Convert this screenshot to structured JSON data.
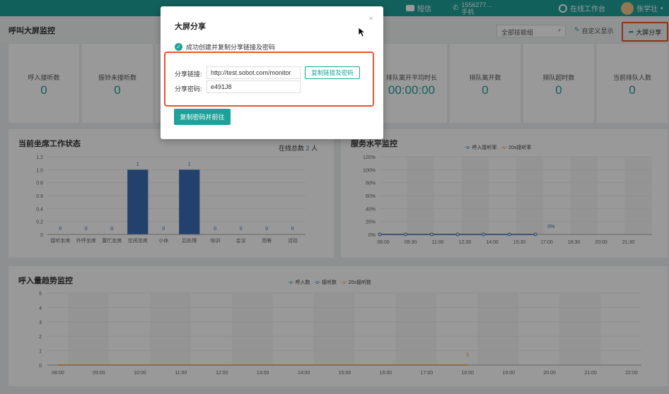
{
  "topbar": {
    "sms_label": "短信",
    "phone_number": "1556277…",
    "phone_label": "手机",
    "workspace_label": "在线工作台",
    "user_name": "张学壮"
  },
  "header": {
    "title": "呼叫大屏监控",
    "skill_group": "全部技能组",
    "custom_display": "自定义显示",
    "share_button": "大屏分享"
  },
  "stats": [
    {
      "label": "呼入接听数",
      "value": "0"
    },
    {
      "label": "振铃未接听数",
      "value": "0"
    },
    {
      "label": "",
      "value": ""
    },
    {
      "label": "",
      "value": ""
    },
    {
      "label": "",
      "value": ""
    },
    {
      "label": "排队离开平均时长",
      "value": "00:00:00"
    },
    {
      "label": "排队离开数",
      "value": "0"
    },
    {
      "label": "排队超时数",
      "value": "0"
    },
    {
      "label": "当前排队人数",
      "value": "0"
    }
  ],
  "agent_panel": {
    "title": "当前坐席工作状态",
    "online_prefix": "在线总数",
    "online_count": "2",
    "online_unit": "人"
  },
  "service_panel": {
    "title": "服务水平监控",
    "legend": [
      "呼入接听率",
      "20s接听率"
    ]
  },
  "trend_panel": {
    "title": "呼入量趋势监控",
    "legend": [
      "呼入数",
      "接听数",
      "20s接听数"
    ]
  },
  "modal": {
    "title": "大屏分享",
    "close": "×",
    "success_text": "成功创建并复制分享链接及密码",
    "link_label": "分享链接:",
    "link_value": "http://test.sobot.com/monitor",
    "password_label": "分享密码:",
    "password_value": "e491J8",
    "copy_button": "复制链接及密码",
    "go_button": "复制密码并前往"
  },
  "colors": {
    "accent": "#1fa09a",
    "highlight": "#e8562e",
    "bar": "#3a6db5",
    "orange": "#f0a030"
  },
  "chart_data": [
    {
      "type": "bar",
      "title": "当前坐席工作状态",
      "categories": [
        "接听坐席",
        "外呼坐席",
        "置忙坐席",
        "空闲坐席",
        "小休",
        "后处理",
        "培训",
        "会议",
        "用餐",
        "活动"
      ],
      "values": [
        0,
        0,
        0,
        1,
        0,
        1,
        0,
        0,
        0,
        0
      ],
      "ylim": [
        0,
        1.2
      ],
      "yticks": [
        "0",
        "0.2",
        "0.4",
        "0.6",
        "0.8",
        "1.0",
        "1.2"
      ],
      "grid": true
    },
    {
      "type": "line",
      "title": "服务水平监控",
      "x": [
        "08:00",
        "09:30",
        "11:00",
        "12:30",
        "14:00",
        "15:30",
        "17:00",
        "18:30",
        "20:00",
        "21:30"
      ],
      "series": [
        {
          "name": "呼入接听率",
          "values": [
            0,
            0,
            0,
            0,
            0,
            0,
            0
          ]
        },
        {
          "name": "20s接听率",
          "values": []
        }
      ],
      "yticks": [
        "0%",
        "20%",
        "40%",
        "60%",
        "80%",
        "100%",
        "120%"
      ],
      "ylim": [
        0,
        120
      ],
      "annotation": "0%",
      "legend_position": "top"
    },
    {
      "type": "line",
      "title": "呼入量趋势监控",
      "x": [
        "08:00",
        "09:00",
        "10:00",
        "11:00",
        "12:00",
        "13:00",
        "14:00",
        "15:00",
        "16:00",
        "17:00",
        "18:00",
        "19:00",
        "20:00",
        "21:00",
        "22:00"
      ],
      "series": [
        {
          "name": "呼入数",
          "values": []
        },
        {
          "name": "接听数",
          "values": []
        },
        {
          "name": "20s接听数",
          "values": [
            0,
            0,
            0,
            0,
            0,
            0,
            0,
            0,
            0,
            0,
            0
          ]
        }
      ],
      "yticks": [
        "0",
        "1",
        "2",
        "3",
        "4",
        "5"
      ],
      "ylim": [
        0,
        5
      ],
      "annotation": "0",
      "legend_position": "top"
    }
  ]
}
